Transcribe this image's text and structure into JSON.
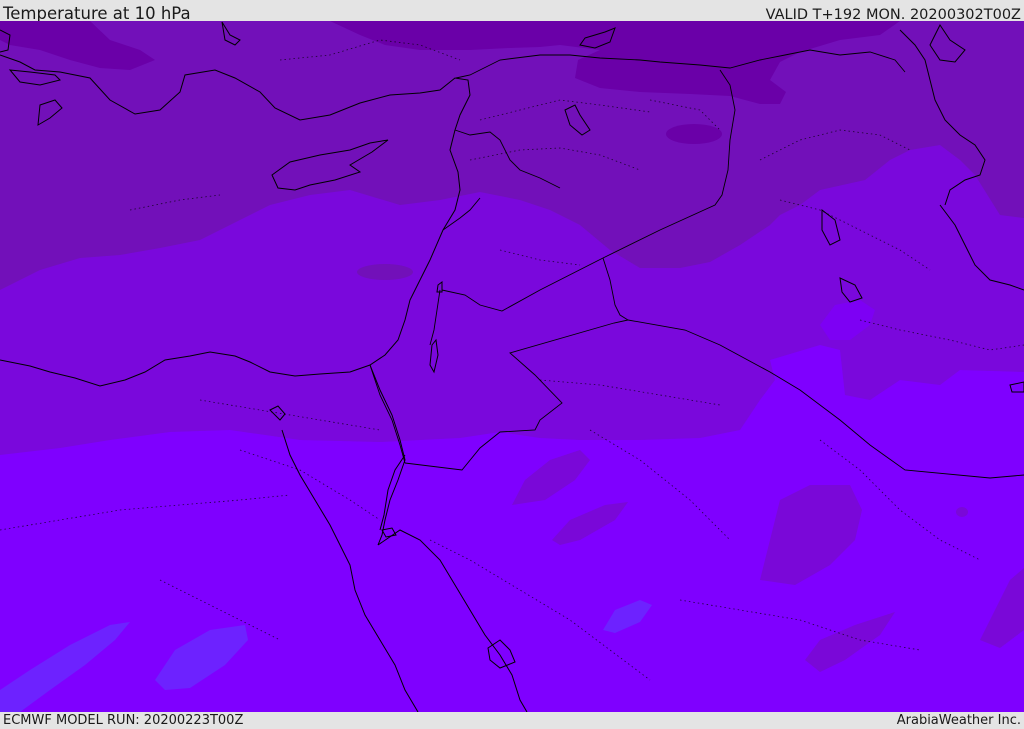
{
  "header": {
    "title": "Temperature at 10 hPa",
    "valid": "VALID T+192 MON. 20200302T00Z"
  },
  "footer": {
    "model_run": "ECMWF MODEL RUN: 20200223T00Z",
    "credit": "ArabiaWeather Inc."
  },
  "map": {
    "field": "temperature",
    "level": "10 hPa",
    "colors": {
      "band_darkest": "#6a00a8",
      "band_dark": "#7210b8",
      "band_mid": "#7a08d8",
      "band_light": "#7d00f4",
      "band_lightest": "#7f00ff",
      "patch_blue": "#6d22ff",
      "coastline": "#000000"
    }
  }
}
